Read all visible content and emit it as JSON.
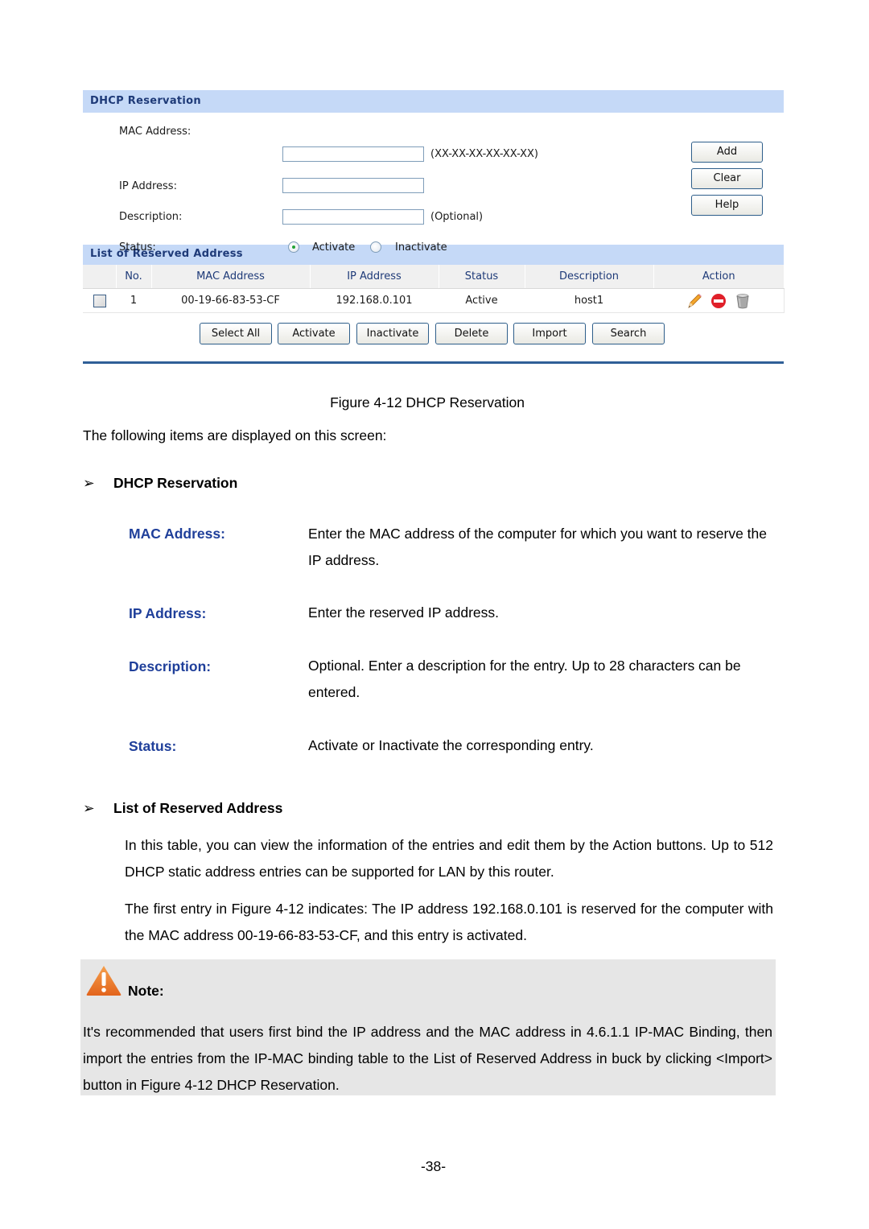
{
  "figure": {
    "reservation_panel": {
      "title": "DHCP Reservation",
      "fields": [
        {
          "label": "MAC Address:",
          "value": "",
          "hint": "(XX-XX-XX-XX-XX-XX)"
        },
        {
          "label": "IP Address:",
          "value": "",
          "hint": ""
        },
        {
          "label": "Description:",
          "value": "",
          "hint": "(Optional)"
        }
      ],
      "status": {
        "label": "Status:",
        "options": [
          "Activate",
          "Inactivate"
        ],
        "selected": "Activate"
      },
      "buttons": {
        "add": "Add",
        "clear": "Clear",
        "help": "Help"
      }
    },
    "list_panel": {
      "title": "List of Reserved Address",
      "columns": [
        "",
        "No.",
        "MAC Address",
        "IP Address",
        "Status",
        "Description",
        "Action"
      ],
      "rows": [
        {
          "checked": false,
          "no": "1",
          "mac": "00-19-66-83-53-CF",
          "ip": "192.168.0.101",
          "status": "Active",
          "description": "host1",
          "actions": [
            "edit-icon",
            "disable-icon",
            "trash-icon"
          ]
        }
      ],
      "buttons": [
        "Select All",
        "Activate",
        "Inactivate",
        "Delete",
        "Import",
        "Search"
      ]
    }
  },
  "doc": {
    "caption": "Figure 4-12 DHCP Reservation",
    "intro": "The following items are displayed on this screen:",
    "bullet_marker": "➢",
    "section1": {
      "heading": "DHCP Reservation",
      "items": [
        {
          "term": "MAC Address:",
          "desc": "Enter the MAC address of the computer for which you want to reserve the IP address."
        },
        {
          "term": "IP Address:",
          "desc": "Enter the reserved IP address."
        },
        {
          "term": "Description:",
          "desc": "Optional. Enter a description for the entry. Up to 28 characters can be entered."
        },
        {
          "term": "Status:",
          "desc": "Activate or Inactivate the corresponding entry."
        }
      ]
    },
    "section2": {
      "heading": "List of Reserved Address",
      "paragraphs": [
        "In this table, you can view the information of the entries and edit them by the Action buttons. Up to 512 DHCP static address entries can be supported for LAN by this router.",
        "The first entry in Figure 4-12 indicates: The IP address 192.168.0.101 is reserved for the computer with the MAC address 00-19-66-83-53-CF, and this entry is activated."
      ]
    },
    "note": {
      "icon": "warning-icon",
      "title": "Note:",
      "body": "It's recommended that users first bind the IP address and the MAC address in 4.6.1.1 IP-MAC Binding, then import the entries from the IP-MAC binding table to the List of Reserved Address in buck by clicking <Import> button in Figure 4-12 DHCP Reservation."
    },
    "page_number": "-38-"
  },
  "colors": {
    "panel_header_bg": "#c5d9f7",
    "panel_header_text": "#1e3a78",
    "term_blue": "#1f3f9a",
    "rule_blue": "#2f5f97",
    "note_bg": "#e6e6e6",
    "warning_orange": "#e8732a"
  }
}
